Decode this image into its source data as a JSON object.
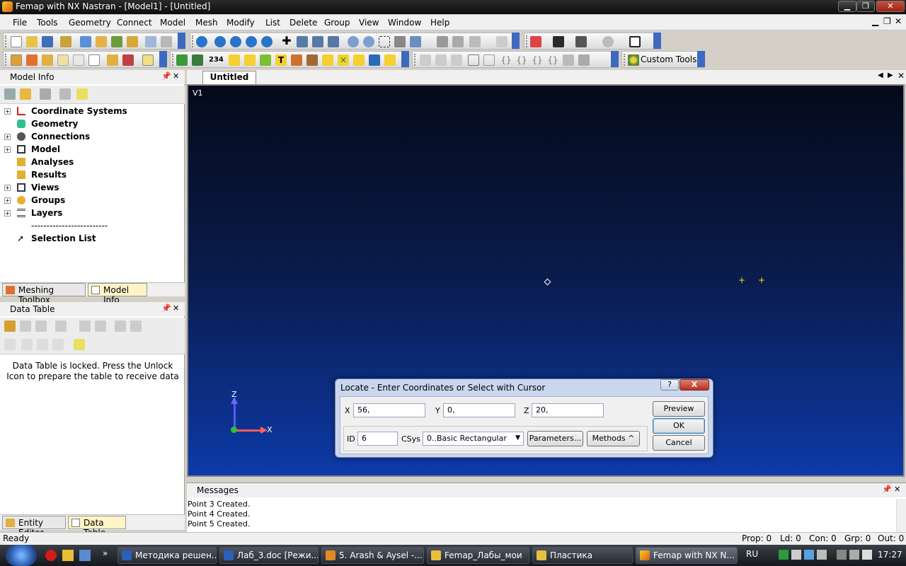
{
  "window": {
    "title": "Femap with NX Nastran - [Model1] - [Untitled]"
  },
  "menu": [
    "File",
    "Tools",
    "Geometry",
    "Connect",
    "Model",
    "Mesh",
    "Modify",
    "List",
    "Delete",
    "Group",
    "View",
    "Window",
    "Help"
  ],
  "toolbar": {
    "custom_tools": "Custom Tools"
  },
  "model_info": {
    "title": "Model Info",
    "items": [
      "Coordinate Systems",
      "Geometry",
      "Connections",
      "Model",
      "Analyses",
      "Results",
      "Views",
      "Groups",
      "Layers",
      "-------------------------",
      "Selection List"
    ]
  },
  "left_tabs": {
    "meshing": "Meshing Toolbox",
    "model_info": "Model Info"
  },
  "data_table": {
    "title": "Data Table",
    "message": "Data Table is locked. Press the Unlock Icon to prepare the table to receive data"
  },
  "left_tabs2": {
    "entity_editor": "Entity Editor",
    "data_table": "Data Table"
  },
  "view": {
    "tab": "Untitled",
    "label": "V1",
    "axis_x": "X",
    "axis_z": "Z"
  },
  "dialog": {
    "title": "Locate - Enter Coordinates or Select with Cursor",
    "x_label": "X",
    "x_value": "56,",
    "y_label": "Y",
    "y_value": "0,",
    "z_label": "Z",
    "z_value": "20,",
    "id_label": "ID",
    "id_value": "6",
    "csys_label": "CSys",
    "csys_value": "0..Basic Rectangular",
    "parameters": "Parameters...",
    "methods": "Methods ^",
    "preview": "Preview",
    "ok": "OK",
    "cancel": "Cancel",
    "help": "?",
    "close": "X"
  },
  "messages": {
    "title": "Messages",
    "lines": [
      "Point 3 Created.",
      "Point 4 Created.",
      "Point 5 Created."
    ]
  },
  "status": {
    "left": "Ready",
    "prop": "Prop: 0",
    "ld": "Ld: 0",
    "con": "Con: 0",
    "grp": "Grp: 0",
    "out": "Out: 0"
  },
  "taskbar": {
    "items": [
      "Методика решен...",
      "Лаб_3.doc [Режи...",
      "5. Arash & Aysel -...",
      "Femap_Лабы_мои",
      "Пластика",
      "Femap with NX N..."
    ],
    "lang": "RU",
    "clock": "17:27"
  }
}
